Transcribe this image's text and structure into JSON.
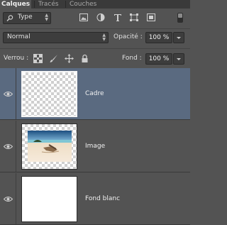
{
  "tabs": [
    {
      "label": "Calques",
      "active": true
    },
    {
      "label": "Tracés",
      "active": false
    },
    {
      "label": "Couches",
      "active": false
    }
  ],
  "filter": {
    "type_label": "Type",
    "icons": [
      "image-filter-icon",
      "adjustment-filter-icon",
      "text-filter-icon",
      "shape-filter-icon",
      "smart-object-filter-icon"
    ]
  },
  "blend": {
    "mode": "Normal",
    "opacity_label": "Opacité :",
    "opacity_value": "100 %"
  },
  "lock": {
    "label": "Verrou :",
    "icons": [
      "lock-transparent-pixels-icon",
      "lock-image-pixels-icon",
      "lock-position-icon",
      "lock-all-icon"
    ],
    "fill_label": "Fond :",
    "fill_value": "100 %"
  },
  "layers": [
    {
      "name": "Cadre",
      "visible": true,
      "selected": true
    },
    {
      "name": "Image",
      "visible": true,
      "selected": false
    },
    {
      "name": "Fond blanc",
      "visible": true,
      "selected": false
    }
  ],
  "colors": {
    "panel_bg": "#535353",
    "tab_bar_bg": "#3a3a3a",
    "selected_layer_bg": "#5a6a80",
    "field_bg": "#3d3d3d"
  }
}
